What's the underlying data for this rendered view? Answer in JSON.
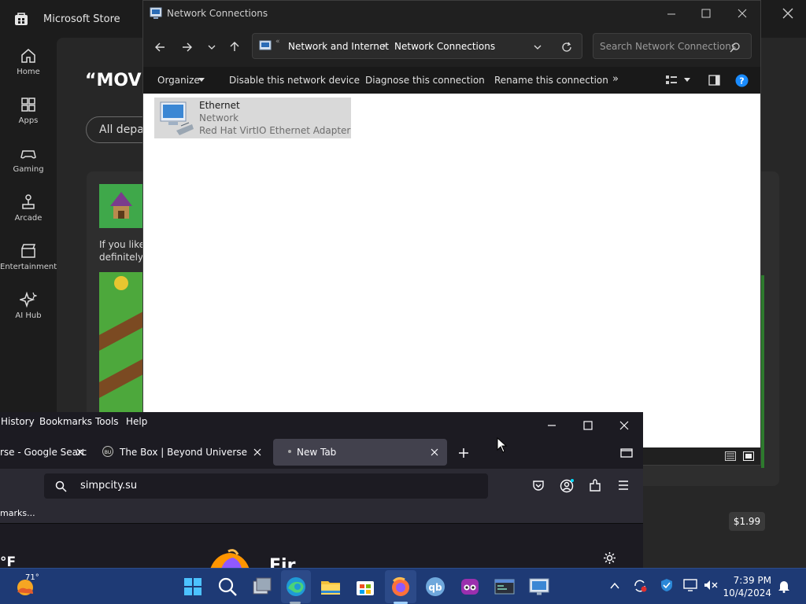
{
  "store": {
    "title": "Microsoft Store",
    "nav": [
      "Home",
      "Apps",
      "Gaming",
      "Arcade",
      "Entertainment",
      "AI Hub"
    ],
    "heading": "“MOVI",
    "pill": "All depar",
    "desc_line1": "If you like",
    "desc_line2": "definitely",
    "price": "$1.99"
  },
  "explorer": {
    "title": "Network Connections",
    "breadcrumb": [
      "Network and Internet",
      "Network Connections"
    ],
    "search_placeholder": "Search Network Connections",
    "commands": [
      "Organize",
      "Disable this network device",
      "Diagnose this connection",
      "Rename this connection"
    ],
    "item": {
      "name": "Ethernet",
      "status": "Network",
      "adapter": "Red Hat VirtIO Ethernet Adapter"
    }
  },
  "firefox": {
    "menu": [
      "History",
      "Bookmarks",
      "Tools",
      "Help"
    ],
    "tabs": [
      {
        "label": "rse - Google Searc"
      },
      {
        "label": "The Box | Beyond Universe Wiki"
      },
      {
        "label": "New Tab"
      }
    ],
    "url": "simpcity.su",
    "bookmarks_label": "marks...",
    "content_partial": "°F"
  },
  "taskbar": {
    "weather": "71°",
    "time": "7:39 PM",
    "date": "10/4/2024"
  },
  "colors": {
    "taskbar": "#1e3a75",
    "accent": "#0078d4",
    "firefox_bg": "#1c1b22"
  }
}
